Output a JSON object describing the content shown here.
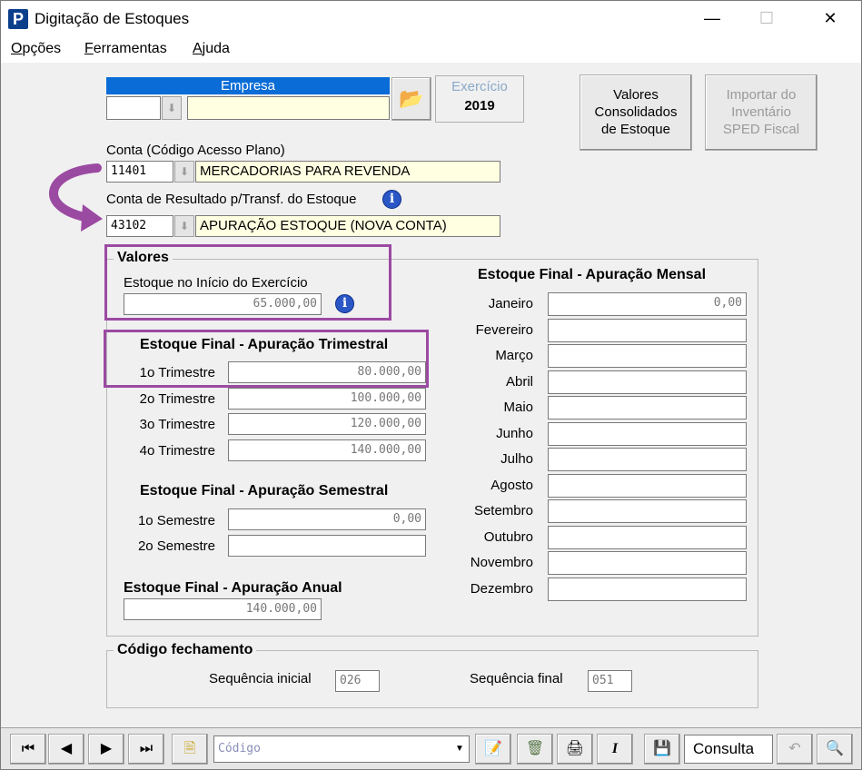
{
  "window": {
    "title": "Digitação de Estoques",
    "app_icon": "P"
  },
  "menu": [
    {
      "key": "O",
      "rest": "pções"
    },
    {
      "key": "F",
      "rest": "erramentas"
    },
    {
      "key": "A",
      "rest": "juda"
    }
  ],
  "empresa": {
    "header": "Empresa",
    "code": "",
    "name": ""
  },
  "exercicio": {
    "label": "Exercício",
    "value": "2019"
  },
  "buttons": {
    "valores": [
      "Valores",
      "Consolidados",
      "de Estoque"
    ],
    "importar": [
      "Importar do",
      "Inventário",
      "SPED Fiscal"
    ]
  },
  "conta": {
    "label": "Conta (Código Acesso Plano)",
    "code": "11401",
    "name": "MERCADORIAS PARA REVENDA"
  },
  "conta_resultado": {
    "label": "Conta de Resultado p/Transf. do Estoque",
    "code": "43102",
    "name": "APURAÇÃO ESTOQUE (NOVA CONTA)"
  },
  "valores": {
    "title": "Valores",
    "inicio_label": "Estoque no Início do Exercício",
    "inicio_value": "65.000,00"
  },
  "trimestral": {
    "title": "Estoque Final - Apuração Trimestral",
    "rows": [
      {
        "label": "1o Trimestre",
        "value": "80.000,00"
      },
      {
        "label": "2o Trimestre",
        "value": "100.000,00"
      },
      {
        "label": "3o Trimestre",
        "value": "120.000,00"
      },
      {
        "label": "4o Trimestre",
        "value": "140.000,00"
      }
    ]
  },
  "semestral": {
    "title": "Estoque Final - Apuração Semestral",
    "rows": [
      {
        "label": "1o Semestre",
        "value": "0,00"
      },
      {
        "label": "2o Semestre",
        "value": ""
      }
    ]
  },
  "anual": {
    "title": "Estoque Final - Apuração Anual",
    "value": "140.000,00"
  },
  "mensal": {
    "title": "Estoque Final - Apuração Mensal",
    "rows": [
      {
        "label": "Janeiro",
        "value": "0,00"
      },
      {
        "label": "Fevereiro",
        "value": ""
      },
      {
        "label": "Março",
        "value": ""
      },
      {
        "label": "Abril",
        "value": ""
      },
      {
        "label": "Maio",
        "value": ""
      },
      {
        "label": "Junho",
        "value": ""
      },
      {
        "label": "Julho",
        "value": ""
      },
      {
        "label": "Agosto",
        "value": ""
      },
      {
        "label": "Setembro",
        "value": ""
      },
      {
        "label": "Outubro",
        "value": ""
      },
      {
        "label": "Novembro",
        "value": ""
      },
      {
        "label": "Dezembro",
        "value": ""
      }
    ]
  },
  "fechamento": {
    "title": "Código fechamento",
    "inicial_label": "Sequência inicial",
    "inicial_value": "026",
    "final_label": "Sequência final",
    "final_value": "051"
  },
  "toolbar": {
    "search_placeholder": "Código",
    "mode": "Consulta",
    "icons": [
      "first-record-icon",
      "previous-record-icon",
      "next-record-icon",
      "last-record-icon",
      "new-document-icon",
      "edit-document-icon",
      "delete-icon",
      "print-icon",
      "italic-icon",
      "save-icon",
      "undo-icon",
      "binoculars-icon"
    ]
  },
  "colors": {
    "highlight": "#9b4aa2",
    "empresa_header": "#0a6cd6",
    "info_icon": "#2b57c6"
  }
}
